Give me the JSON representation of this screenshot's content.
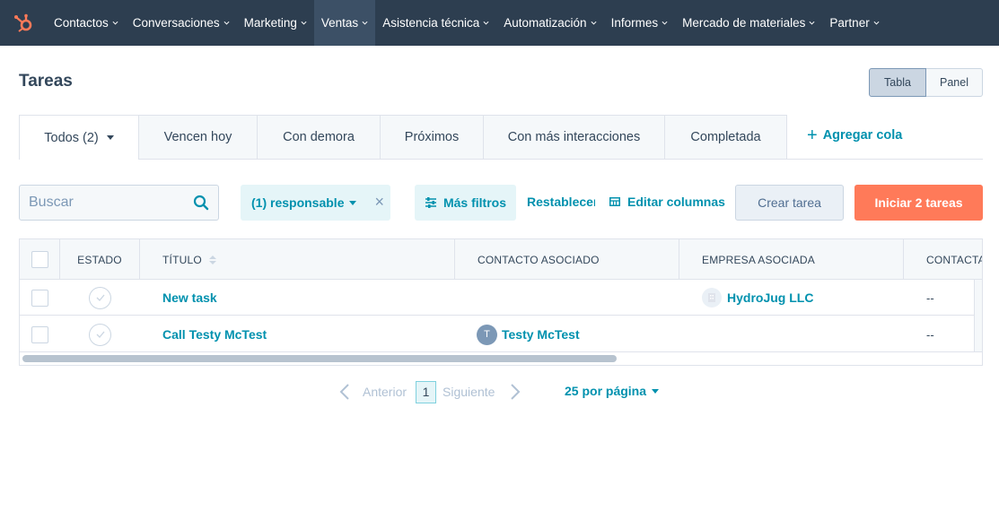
{
  "nav": {
    "items": [
      {
        "label": "Contactos"
      },
      {
        "label": "Conversaciones"
      },
      {
        "label": "Marketing"
      },
      {
        "label": "Ventas"
      },
      {
        "label": "Asistencia técnica"
      },
      {
        "label": "Automatización"
      },
      {
        "label": "Informes"
      },
      {
        "label": "Mercado de materiales"
      },
      {
        "label": "Partner"
      }
    ],
    "active": "Ventas"
  },
  "header": {
    "title": "Tareas",
    "view_table": "Tabla",
    "view_board": "Panel"
  },
  "tabs": [
    {
      "label": "Todos (2)"
    },
    {
      "label": "Vencen hoy"
    },
    {
      "label": "Con demora"
    },
    {
      "label": "Próximos"
    },
    {
      "label": "Con más interacciones"
    },
    {
      "label": "Completada"
    }
  ],
  "add_queue": "Agregar cola",
  "filters": {
    "search_placeholder": "Buscar",
    "owner_chip": "(1) responsable",
    "more_filters": "Más filtros",
    "reset": "Restablecer",
    "edit_columns": "Editar columnas",
    "create_task": "Crear tarea",
    "start_tasks": "Iniciar 2 tareas"
  },
  "table": {
    "columns": [
      "ESTADO",
      "TÍTULO",
      "CONTACTO ASOCIADO",
      "EMPRESA ASOCIADA",
      "CONTACTA"
    ],
    "rows": [
      {
        "title": "New task",
        "contact": "",
        "contact_initial": "",
        "company": "HydroJug LLC",
        "last": "--"
      },
      {
        "title": "Call Testy McTest",
        "contact": "Testy McTest",
        "contact_initial": "T",
        "company": "",
        "last": "--"
      }
    ]
  },
  "pagination": {
    "prev": "Anterior",
    "page": "1",
    "next": "Siguiente",
    "per_page": "25 por página"
  },
  "colors": {
    "nav_bg": "#2d3e50",
    "link": "#0091ae",
    "primary_button": "#ff7a59",
    "brand_logo": "#ff7a59"
  }
}
